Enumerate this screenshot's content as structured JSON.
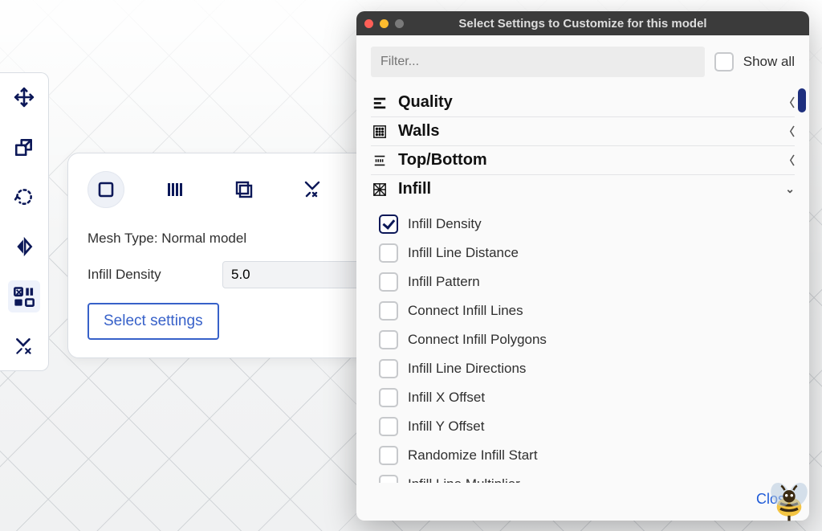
{
  "toolbar": {
    "items": [
      {
        "name": "move-tool"
      },
      {
        "name": "scale-tool"
      },
      {
        "name": "rotate-tool"
      },
      {
        "name": "mirror-tool"
      },
      {
        "name": "per-model-tool"
      },
      {
        "name": "support-blocker-tool"
      }
    ],
    "active": "per-model-tool"
  },
  "model_panel": {
    "tabs": [
      {
        "name": "mesh-normal-tab",
        "selected": true
      },
      {
        "name": "mesh-infill-tab"
      },
      {
        "name": "mesh-cutting-tab"
      },
      {
        "name": "mesh-anti-overhang-tab"
      }
    ],
    "mesh_type_label": "Mesh Type: Normal model",
    "infill_label": "Infill Density",
    "infill_value": "5.0",
    "select_settings_label": "Select settings"
  },
  "dialog": {
    "title": "Select Settings to Customize for this model",
    "filter_placeholder": "Filter...",
    "show_all_label": "Show all",
    "show_all_checked": false,
    "categories": [
      {
        "key": "quality",
        "label": "Quality",
        "icon": "quality-icon",
        "expanded": false
      },
      {
        "key": "walls",
        "label": "Walls",
        "icon": "walls-icon",
        "expanded": false
      },
      {
        "key": "topbottom",
        "label": "Top/Bottom",
        "icon": "topbottom-icon",
        "expanded": false
      },
      {
        "key": "infill",
        "label": "Infill",
        "icon": "infill-icon",
        "expanded": true
      }
    ],
    "infill_options": [
      {
        "label": "Infill Density",
        "checked": true
      },
      {
        "label": "Infill Line Distance",
        "checked": false
      },
      {
        "label": "Infill Pattern",
        "checked": false
      },
      {
        "label": "Connect Infill Lines",
        "checked": false
      },
      {
        "label": "Connect Infill Polygons",
        "checked": false
      },
      {
        "label": "Infill Line Directions",
        "checked": false
      },
      {
        "label": "Infill X Offset",
        "checked": false
      },
      {
        "label": "Infill Y Offset",
        "checked": false
      },
      {
        "label": "Randomize Infill Start",
        "checked": false
      },
      {
        "label": "Infill Line Multiplier",
        "checked": false
      }
    ],
    "close_label": "Close"
  }
}
